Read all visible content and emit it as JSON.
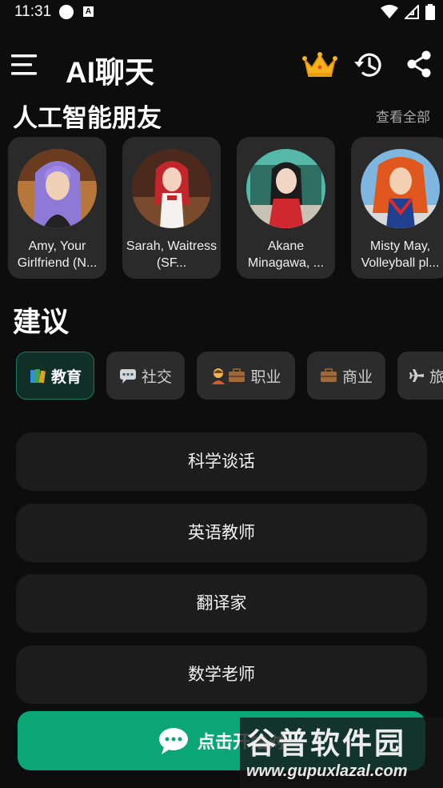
{
  "status_bar": {
    "time": "11:31",
    "notification_letter": "A"
  },
  "app_bar": {
    "title": "AI聊天"
  },
  "friends_section": {
    "title": "人工智能朋友",
    "view_all": "查看全部",
    "characters": [
      {
        "name": "Amy, Your Girlfriend (N..."
      },
      {
        "name": "Sarah, Waitress (SF..."
      },
      {
        "name": "Akane Minagawa, ..."
      },
      {
        "name": "Misty May, Volleyball pl..."
      }
    ]
  },
  "suggestions_section": {
    "title": "建议",
    "categories": [
      {
        "label": "教育",
        "icon": "books-icon",
        "selected": true
      },
      {
        "label": "社交",
        "icon": "speech-bubble-icon",
        "selected": false
      },
      {
        "label": "职业",
        "icon": "person-briefcase-icon",
        "selected": false
      },
      {
        "label": "商业",
        "icon": "briefcase-icon",
        "selected": false
      },
      {
        "label": "旅",
        "icon": "airplane-icon",
        "selected": false
      }
    ],
    "topics": [
      "科学谈话",
      "英语教师",
      "翻译家",
      "数学老师"
    ]
  },
  "start_button": {
    "label": "点击开始对",
    "icon": "chat-bubble-icon"
  },
  "watermark": {
    "title": "谷普软件园",
    "url": "www.gupuxlazal.com"
  },
  "colors": {
    "accent": "#0aa675",
    "background": "#0d0d0d",
    "card": "#2a2a2a",
    "chip_active": "#0f2f27"
  }
}
